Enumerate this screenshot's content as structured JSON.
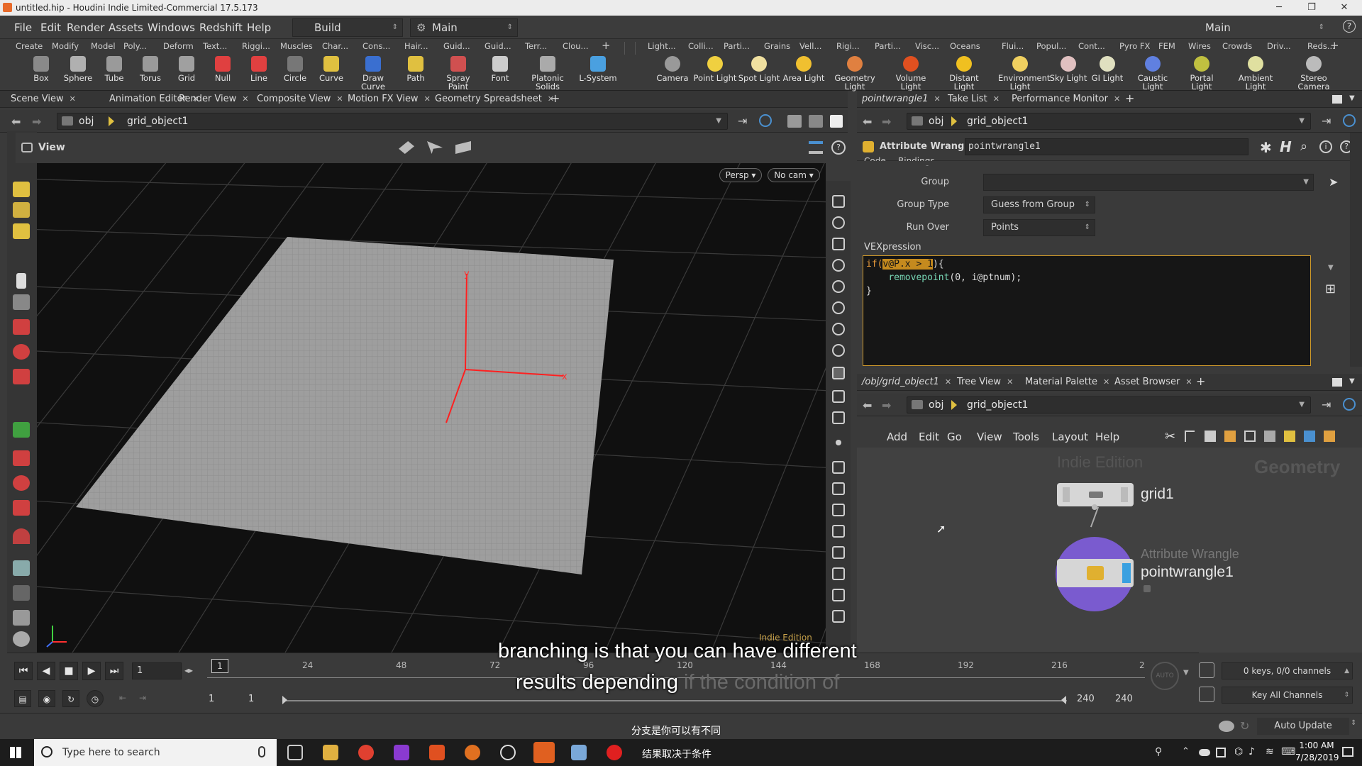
{
  "window": {
    "title": "untitled.hip - Houdini Indie Limited-Commercial 17.5.173"
  },
  "menubar": {
    "items": [
      "File",
      "Edit",
      "Render",
      "Assets",
      "Windows",
      "Redshift",
      "Help"
    ],
    "desktop_label": "Build",
    "context_label": "Main",
    "right_label": "Main"
  },
  "shelf": {
    "left_tabs": [
      "Create",
      "Modify",
      "Model",
      "Poly...",
      "Deform",
      "Text...",
      "Riggi...",
      "Muscles",
      "Char...",
      "Cons...",
      "Hair...",
      "Guid...",
      "Guid...",
      "Terr...",
      "Clou..."
    ],
    "right_tabs": [
      "Light...",
      "Colli...",
      "Parti...",
      "Grains",
      "Vell...",
      "Rigi...",
      "Parti...",
      "Visc...",
      "Oceans",
      "Flui...",
      "Popul...",
      "Cont...",
      "Pyro FX",
      "FEM",
      "Wires",
      "Crowds",
      "Driv...",
      "Reds..."
    ],
    "left_tools": [
      {
        "label": "Box",
        "color": "#8a8a8a"
      },
      {
        "label": "Sphere",
        "color": "#b0b0b0"
      },
      {
        "label": "Tube",
        "color": "#9a9a9a"
      },
      {
        "label": "Torus",
        "color": "#9a9a9a"
      },
      {
        "label": "Grid",
        "color": "#a0a0a0"
      },
      {
        "label": "Null",
        "color": "#e04040"
      },
      {
        "label": "Line",
        "color": "#e04040"
      },
      {
        "label": "Circle",
        "color": "#777"
      },
      {
        "label": "Curve",
        "color": "#e0c040"
      },
      {
        "label": "Draw Curve",
        "color": "#3a6fd0"
      },
      {
        "label": "Path",
        "color": "#e0c040"
      },
      {
        "label": "Spray Paint",
        "color": "#d05050"
      },
      {
        "label": "Font",
        "color": "#cccccc"
      },
      {
        "label": "Platonic Solids",
        "color": "#aaaaaa"
      },
      {
        "label": "L-System",
        "color": "#4aa0e0"
      }
    ],
    "right_tools": [
      {
        "label": "Camera",
        "color": "#999"
      },
      {
        "label": "Point Light",
        "color": "#f0d040"
      },
      {
        "label": "Spot Light",
        "color": "#f0e0a0"
      },
      {
        "label": "Area Light",
        "color": "#f0c030"
      },
      {
        "label": "Geometry Light",
        "color": "#e08040"
      },
      {
        "label": "Volume Light",
        "color": "#e05020"
      },
      {
        "label": "Distant Light",
        "color": "#f0c020"
      },
      {
        "label": "Environment Light",
        "color": "#f0d060"
      },
      {
        "label": "Sky Light",
        "color": "#e0c0c0"
      },
      {
        "label": "GI Light",
        "color": "#e0e0c0"
      },
      {
        "label": "Caustic Light",
        "color": "#6080e0"
      },
      {
        "label": "Portal Light",
        "color": "#c0c040"
      },
      {
        "label": "Ambient Light",
        "color": "#e0e0a0"
      },
      {
        "label": "Stereo Camera",
        "color": "#bbb"
      }
    ]
  },
  "left_pane": {
    "tabs": [
      "Scene View",
      "Animation Editor",
      "Render View",
      "Composite View",
      "Motion FX View",
      "Geometry Spreadsheet"
    ],
    "path": {
      "root": "obj",
      "node": "grid_object1"
    },
    "view_label": "View",
    "persp_btn": "Persp",
    "cam_btn": "No cam",
    "watermark": "Indie Edition"
  },
  "param_pane": {
    "tabs": [
      "pointwrangle1",
      "Take List",
      "Performance Monitor"
    ],
    "path": {
      "root": "obj",
      "node": "grid_object1"
    },
    "node_type": "Attribute Wrangle",
    "node_name": "pointwrangle1",
    "sub_tabs": [
      "Code",
      "Bindings"
    ],
    "group_label": "Group",
    "group_value": "",
    "group_type_label": "Group Type",
    "group_type_value": "Guess from Group",
    "run_over_label": "Run Over",
    "run_over_value": "Points",
    "vex_label": "VEXpression",
    "code": {
      "l1_kw": "if(",
      "l1_hl": "v@P.x > 1",
      "l1_end": "){",
      "l2_indent": "    ",
      "l2_fn": "removepoint",
      "l2_rest": "(0, i@ptnum);",
      "l3": "}"
    }
  },
  "network_pane": {
    "tabs": [
      "/obj/grid_object1",
      "Tree View",
      "Material Palette",
      "Asset Browser"
    ],
    "path": {
      "root": "obj",
      "node": "grid_object1"
    },
    "menu": [
      "Add",
      "Edit",
      "Go",
      "View",
      "Tools",
      "Layout",
      "Help"
    ],
    "watermark": "Indie Edition",
    "context": "Geometry",
    "nodes": {
      "grid": {
        "name": "grid1"
      },
      "wrangle": {
        "type": "Attribute Wrangle",
        "name": "pointwrangle1"
      }
    }
  },
  "timeline": {
    "current_frame": "1",
    "frame_marker": "1",
    "ticks": [
      "24",
      "48",
      "72",
      "96",
      "120",
      "144",
      "168",
      "192",
      "216",
      "2"
    ],
    "start": "1",
    "start2": "1",
    "end": "240",
    "end2": "240",
    "keys_status": "0 keys, 0/0 channels",
    "key_all": "Key All Channels",
    "auto_update": "Auto Update"
  },
  "subtitles": {
    "en_line1": "branching is that you can have different",
    "en_line2a": "results depending",
    "en_line2b": " if the condition of",
    "zh_line1": "分支是你可以有不同",
    "zh_line2": "结果取决于条件"
  },
  "taskbar": {
    "search_placeholder": "Type here to search",
    "time": "1:00 AM",
    "date": "7/28/2019"
  }
}
